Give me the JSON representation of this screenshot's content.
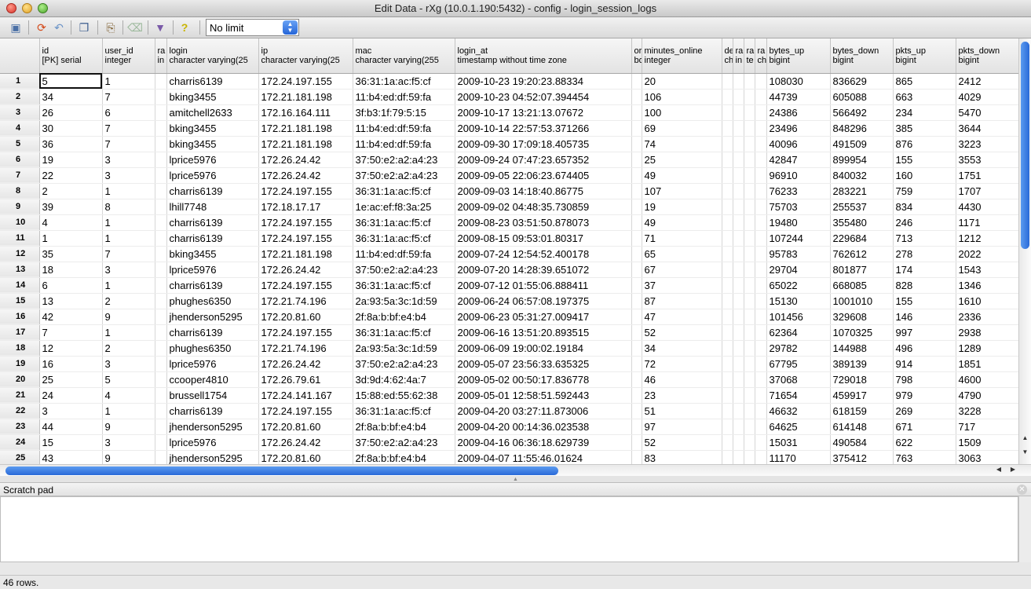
{
  "window": {
    "title": "Edit Data - rXg (10.0.1.190:5432) - config - login_session_logs"
  },
  "toolbar": {
    "icons": [
      "save-icon",
      "refresh-icon",
      "undo-icon",
      "copy-icon",
      "paste-icon",
      "delete-icon",
      "filter-icon",
      "help-icon"
    ],
    "limit_value": "No limit"
  },
  "columns": [
    {
      "name": "id",
      "type": "[PK] serial"
    },
    {
      "name": "user_id",
      "type": "integer"
    },
    {
      "name": "ra",
      "type": "in"
    },
    {
      "name": "login",
      "type": "character varying(25"
    },
    {
      "name": "ip",
      "type": "character varying(25"
    },
    {
      "name": "mac",
      "type": "character varying(255"
    },
    {
      "name": "login_at",
      "type": "timestamp without time zone"
    },
    {
      "name": "or",
      "type": "bo"
    },
    {
      "name": "minutes_online",
      "type": "integer"
    },
    {
      "name": "de",
      "type": "ch"
    },
    {
      "name": "ra",
      "type": "in"
    },
    {
      "name": "ra",
      "type": "te"
    },
    {
      "name": "ra",
      "type": "ch"
    },
    {
      "name": "bytes_up",
      "type": "bigint"
    },
    {
      "name": "bytes_down",
      "type": "bigint"
    },
    {
      "name": "pkts_up",
      "type": "bigint"
    },
    {
      "name": "pkts_down",
      "type": "bigint"
    }
  ],
  "rows": [
    [
      "1",
      "5",
      "1",
      "charris6139",
      "172.24.197.155",
      "36:31:1a:ac:f5:cf",
      "2009-10-23 19:20:23.88334",
      "20",
      "108030",
      "836629",
      "865",
      "2412"
    ],
    [
      "2",
      "34",
      "7",
      "bking3455",
      "172.21.181.198",
      "11:b4:ed:df:59:fa",
      "2009-10-23 04:52:07.394454",
      "106",
      "44739",
      "605088",
      "663",
      "4029"
    ],
    [
      "3",
      "26",
      "6",
      "amitchell2633",
      "172.16.164.111",
      "3f:b3:1f:79:5:15",
      "2009-10-17 13:21:13.07672",
      "100",
      "24386",
      "566492",
      "234",
      "5470"
    ],
    [
      "4",
      "30",
      "7",
      "bking3455",
      "172.21.181.198",
      "11:b4:ed:df:59:fa",
      "2009-10-14 22:57:53.371266",
      "69",
      "23496",
      "848296",
      "385",
      "3644"
    ],
    [
      "5",
      "36",
      "7",
      "bking3455",
      "172.21.181.198",
      "11:b4:ed:df:59:fa",
      "2009-09-30 17:09:18.405735",
      "74",
      "40096",
      "491509",
      "876",
      "3223"
    ],
    [
      "6",
      "19",
      "3",
      "lprice5976",
      "172.26.24.42",
      "37:50:e2:a2:a4:23",
      "2009-09-24 07:47:23.657352",
      "25",
      "42847",
      "899954",
      "155",
      "3553"
    ],
    [
      "7",
      "22",
      "3",
      "lprice5976",
      "172.26.24.42",
      "37:50:e2:a2:a4:23",
      "2009-09-05 22:06:23.674405",
      "49",
      "96910",
      "840032",
      "160",
      "1751"
    ],
    [
      "8",
      "2",
      "1",
      "charris6139",
      "172.24.197.155",
      "36:31:1a:ac:f5:cf",
      "2009-09-03 14:18:40.86775",
      "107",
      "76233",
      "283221",
      "759",
      "1707"
    ],
    [
      "9",
      "39",
      "8",
      "lhill7748",
      "172.18.17.17",
      "1e:ac:ef:f8:3a:25",
      "2009-09-02 04:48:35.730859",
      "19",
      "75703",
      "255537",
      "834",
      "4430"
    ],
    [
      "10",
      "4",
      "1",
      "charris6139",
      "172.24.197.155",
      "36:31:1a:ac:f5:cf",
      "2009-08-23 03:51:50.878073",
      "49",
      "19480",
      "355480",
      "246",
      "1171"
    ],
    [
      "11",
      "1",
      "1",
      "charris6139",
      "172.24.197.155",
      "36:31:1a:ac:f5:cf",
      "2009-08-15 09:53:01.80317",
      "71",
      "107244",
      "229684",
      "713",
      "1212"
    ],
    [
      "12",
      "35",
      "7",
      "bking3455",
      "172.21.181.198",
      "11:b4:ed:df:59:fa",
      "2009-07-24 12:54:52.400178",
      "65",
      "95783",
      "762612",
      "278",
      "2022"
    ],
    [
      "13",
      "18",
      "3",
      "lprice5976",
      "172.26.24.42",
      "37:50:e2:a2:a4:23",
      "2009-07-20 14:28:39.651072",
      "67",
      "29704",
      "801877",
      "174",
      "1543"
    ],
    [
      "14",
      "6",
      "1",
      "charris6139",
      "172.24.197.155",
      "36:31:1a:ac:f5:cf",
      "2009-07-12 01:55:06.888411",
      "37",
      "65022",
      "668085",
      "828",
      "1346"
    ],
    [
      "15",
      "13",
      "2",
      "phughes6350",
      "172.21.74.196",
      "2a:93:5a:3c:1d:59",
      "2009-06-24 06:57:08.197375",
      "87",
      "15130",
      "1001010",
      "155",
      "1610"
    ],
    [
      "16",
      "42",
      "9",
      "jhenderson5295",
      "172.20.81.60",
      "2f:8a:b:bf:e4:b4",
      "2009-06-23 05:31:27.009417",
      "47",
      "101456",
      "329608",
      "146",
      "2336"
    ],
    [
      "17",
      "7",
      "1",
      "charris6139",
      "172.24.197.155",
      "36:31:1a:ac:f5:cf",
      "2009-06-16 13:51:20.893515",
      "52",
      "62364",
      "1070325",
      "997",
      "2938"
    ],
    [
      "18",
      "12",
      "2",
      "phughes6350",
      "172.21.74.196",
      "2a:93:5a:3c:1d:59",
      "2009-06-09 19:00:02.19184",
      "34",
      "29782",
      "144988",
      "496",
      "1289"
    ],
    [
      "19",
      "16",
      "3",
      "lprice5976",
      "172.26.24.42",
      "37:50:e2:a2:a4:23",
      "2009-05-07 23:56:33.635325",
      "72",
      "67795",
      "389139",
      "914",
      "1851"
    ],
    [
      "20",
      "25",
      "5",
      "ccooper4810",
      "172.26.79.61",
      "3d:9d:4:62:4a:7",
      "2009-05-02 00:50:17.836778",
      "46",
      "37068",
      "729018",
      "798",
      "4600"
    ],
    [
      "21",
      "24",
      "4",
      "brussell1754",
      "172.24.141.167",
      "15:88:ed:55:62:38",
      "2009-05-01 12:58:51.592443",
      "23",
      "71654",
      "459917",
      "979",
      "4790"
    ],
    [
      "22",
      "3",
      "1",
      "charris6139",
      "172.24.197.155",
      "36:31:1a:ac:f5:cf",
      "2009-04-20 03:27:11.873006",
      "51",
      "46632",
      "618159",
      "269",
      "3228"
    ],
    [
      "23",
      "44",
      "9",
      "jhenderson5295",
      "172.20.81.60",
      "2f:8a:b:bf:e4:b4",
      "2009-04-20 00:14:36.023538",
      "97",
      "64625",
      "614148",
      "671",
      "717"
    ],
    [
      "24",
      "15",
      "3",
      "lprice5976",
      "172.26.24.42",
      "37:50:e2:a2:a4:23",
      "2009-04-16 06:36:18.629739",
      "52",
      "15031",
      "490584",
      "622",
      "1509"
    ],
    [
      "25",
      "43",
      "9",
      "jhenderson5295",
      "172.20.81.60",
      "2f:8a:b:bf:e4:b4",
      "2009-04-07 11:55:46.01624",
      "83",
      "11170",
      "375412",
      "763",
      "3063"
    ]
  ],
  "scratch_pad": {
    "title": "Scratch pad"
  },
  "status": {
    "text": "46 rows."
  }
}
